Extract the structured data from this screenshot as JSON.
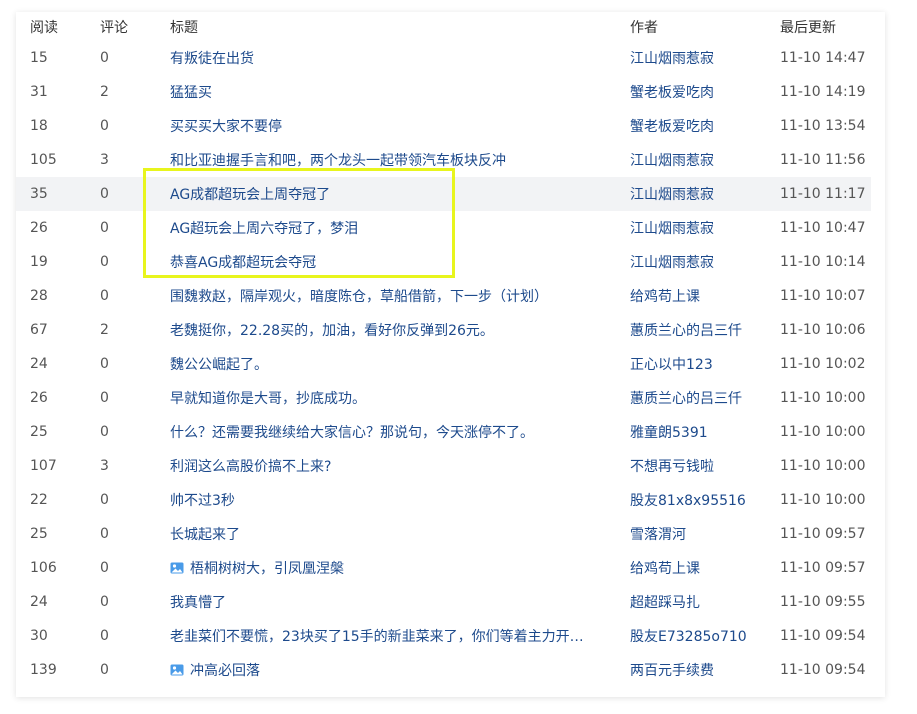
{
  "header": {
    "read": "阅读",
    "comment": "评论",
    "title": "标题",
    "author": "作者",
    "updated": "最后更新"
  },
  "rows": [
    {
      "read": "15",
      "comment": "0",
      "title": "有叛徒在出货",
      "author": "江山烟雨惹寂",
      "time": "11-10 14:47"
    },
    {
      "read": "31",
      "comment": "2",
      "title": "猛猛买",
      "author": "蟹老板爱吃肉",
      "time": "11-10 14:19"
    },
    {
      "read": "18",
      "comment": "0",
      "title": "买买买大家不要停",
      "author": "蟹老板爱吃肉",
      "time": "11-10 13:54"
    },
    {
      "read": "105",
      "comment": "3",
      "title": "和比亚迪握手言和吧，两个龙头一起带领汽车板块反冲",
      "author": "江山烟雨惹寂",
      "time": "11-10 11:56"
    },
    {
      "read": "35",
      "comment": "0",
      "title": "AG成都超玩会上周夺冠了",
      "author": "江山烟雨惹寂",
      "time": "11-10 11:17"
    },
    {
      "read": "26",
      "comment": "0",
      "title": "AG超玩会上周六夺冠了，梦泪",
      "author": "江山烟雨惹寂",
      "time": "11-10 10:47"
    },
    {
      "read": "19",
      "comment": "0",
      "title": "恭喜AG成都超玩会夺冠",
      "author": "江山烟雨惹寂",
      "time": "11-10 10:14"
    },
    {
      "read": "28",
      "comment": "0",
      "title": "围魏救赵，隔岸观火，暗度陈仓，草船借箭，下一步（计划）",
      "author": "给鸡苟上课",
      "time": "11-10 10:07"
    },
    {
      "read": "67",
      "comment": "2",
      "title": "老魏挺你，22.28买的，加油，看好你反弹到26元。",
      "author": "蕙质兰心的吕三仟",
      "time": "11-10 10:06"
    },
    {
      "read": "24",
      "comment": "0",
      "title": "魏公公崛起了。",
      "author": "正心以中123",
      "time": "11-10 10:02"
    },
    {
      "read": "26",
      "comment": "0",
      "title": "早就知道你是大哥，抄底成功。",
      "author": "蕙质兰心的吕三仟",
      "time": "11-10 10:00"
    },
    {
      "read": "25",
      "comment": "0",
      "title": "什么？还需要我继续给大家信心？那说句，今天涨停不了。",
      "author": "雅童朗5391",
      "time": "11-10 10:00"
    },
    {
      "read": "107",
      "comment": "3",
      "title": "利润这么高股价搞不上来?",
      "author": "不想再亏钱啦",
      "time": "11-10 10:00"
    },
    {
      "read": "22",
      "comment": "0",
      "title": "帅不过3秒",
      "author": "股友81x8x95516",
      "time": "11-10 10:00"
    },
    {
      "read": "25",
      "comment": "0",
      "title": "长城起来了",
      "author": "雪落渭河",
      "time": "11-10 09:57"
    },
    {
      "read": "106",
      "comment": "0",
      "title": "梧桐树树大，引凤凰涅槃",
      "author": "给鸡苟上课",
      "time": "11-10 09:57",
      "icon": "image-icon"
    },
    {
      "read": "24",
      "comment": "0",
      "title": "我真懵了",
      "author": "超超踩马扎",
      "time": "11-10 09:55"
    },
    {
      "read": "30",
      "comment": "0",
      "title": "老韭菜们不要慌，23块买了15手的新韭菜来了，你们等着主力开…",
      "author": "股友E73285o710",
      "time": "11-10 09:54"
    },
    {
      "read": "139",
      "comment": "0",
      "title": "冲高必回落",
      "author": "两百元手续费",
      "time": "11-10 09:54",
      "icon": "image-icon"
    }
  ],
  "colors": {
    "link": "#1d4a8c",
    "highlight_border": "#e8f51d",
    "hover_row": "#f2f3f5"
  }
}
